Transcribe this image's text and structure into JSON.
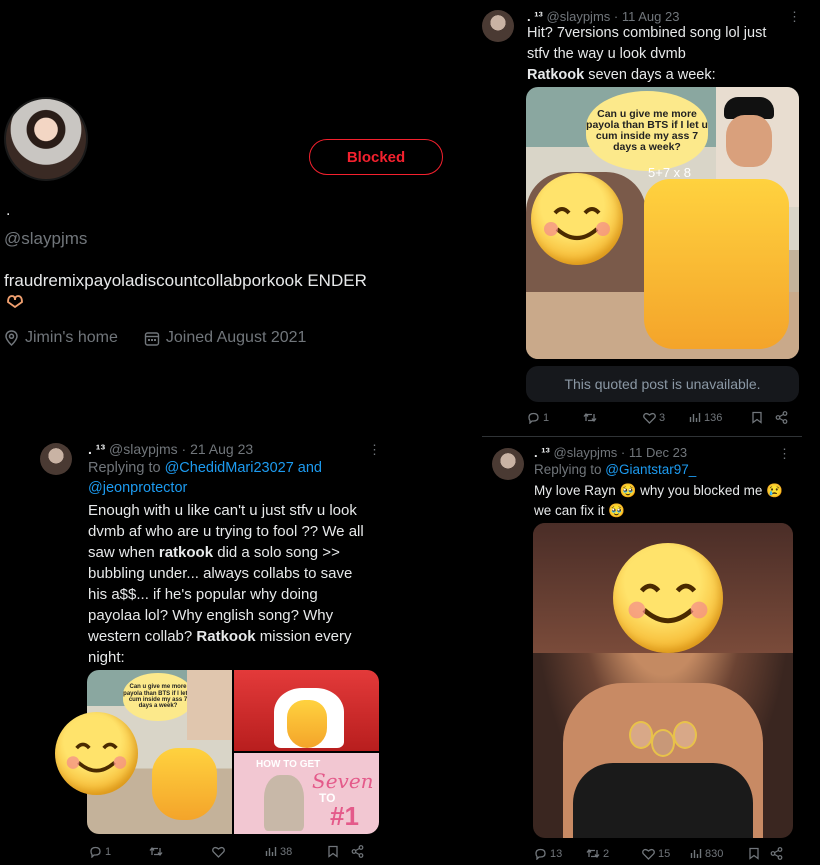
{
  "profile": {
    "name": ".",
    "handle": "@slaypjms",
    "blocked_label": "Blocked",
    "bio": "fraudremixpayoladiscountcollabporkook ENDER",
    "location": "Jimin's home",
    "joined": "Joined August 2021"
  },
  "tweet_top": {
    "name": ". ¹³",
    "handle_date": "@slaypjms · 11 Aug 23",
    "text_line1": "Hit? 7versions combined song lol just",
    "text_line2": "stfv the way u look dvmb",
    "bold_word": "Ratkook",
    "text_line3_rest": " seven days a week:",
    "image_caption": "Can u give me more payola than BTS if I let u cum inside my ass 7 days a week?",
    "equation": "5+7 x 8",
    "quoted_unavailable": "This quoted post is unavailable.",
    "replies": "1",
    "retweets": "",
    "likes": "3",
    "views": "136"
  },
  "tweet_left": {
    "name": ". ¹³",
    "handle_date": "@slaypjms · 21 Aug 23",
    "replying_to_prefix": "Replying to ",
    "replying_to_1": "@ChedidMari23027 and",
    "replying_to_2": "@jeonprotector",
    "lines": [
      "Enough with u like can't u just stfv u look",
      "dvmb af who are u trying to fool ?? We all",
      "saw when "
    ],
    "bold_1": "ratkook",
    "line3_rest": " did a solo song >>",
    "lines2": [
      "bubbling under... always collabs to save",
      "his a$$... if he's popular why doing",
      "payolaa lol? Why english song? Why",
      "western collab? "
    ],
    "bold_2": "Ratkook",
    "line7_rest": " mission every",
    "line8": "night:",
    "image_caption": "Can u give me more payola than BTS if I let u cum inside my ass 7 days a week?",
    "poster_text_1": "HOW TO GET",
    "poster_text_2": "Seven",
    "poster_text_3": "TO",
    "poster_text_4": "#1",
    "replies": "1",
    "retweets": "",
    "likes": "",
    "views": "38"
  },
  "tweet_right": {
    "name": ". ¹³",
    "handle_date": "@slaypjms · 11 Dec 23",
    "replying_to_prefix": "Replying to ",
    "replying_to": "@Giantstar97_",
    "line1": "My love Rayn 🥹 why you blocked me 😢",
    "line2": "we can fix it 🥹",
    "replies": "13",
    "retweets": "2",
    "likes": "15",
    "views": "830"
  },
  "colors": {
    "accent": "#1d9bf0",
    "blocked": "#f4212e",
    "muted": "#71767b"
  }
}
